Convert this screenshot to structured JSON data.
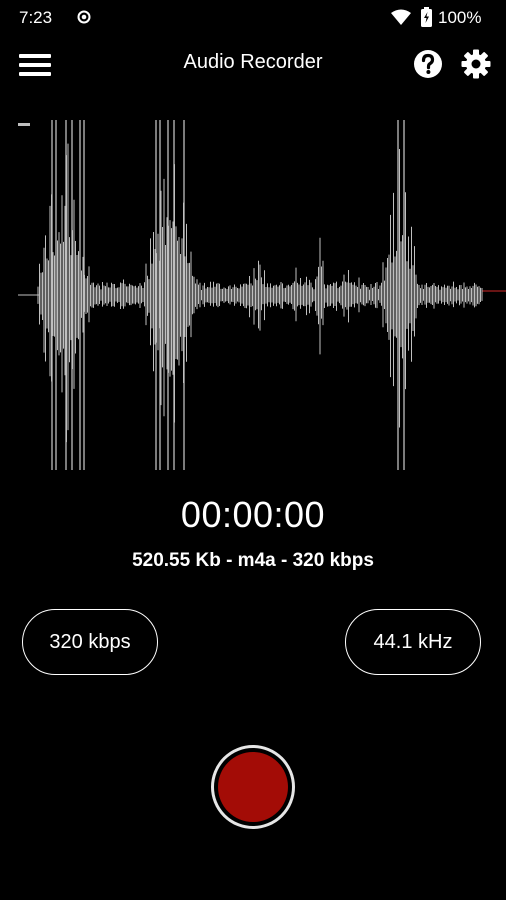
{
  "status_bar": {
    "time": "7:23",
    "battery": "100%",
    "icons": [
      "record-indicator-icon",
      "wifi-icon",
      "battery-charging-icon"
    ]
  },
  "app_bar": {
    "title": "Audio Recorder",
    "icons": [
      "menu-icon",
      "help-icon",
      "settings-icon"
    ]
  },
  "recorder": {
    "timer": "00:00:00",
    "file_info": "520.55 Kb - m4a - 320 kbps",
    "bitrate_option": "320 kbps",
    "samplerate_option": "44.1 kHz"
  },
  "colors": {
    "background": "#000000",
    "waveform": "#bfbfbf",
    "record_button": "#a30c06",
    "playhead": "#8a1a1a"
  }
}
